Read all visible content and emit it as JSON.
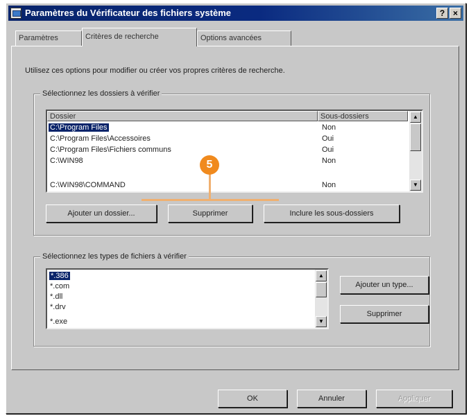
{
  "window": {
    "title": "Paramètres du Vérificateur des fichiers système",
    "help_label": "?",
    "close_label": "×"
  },
  "tabs": [
    {
      "label": "Paramètres"
    },
    {
      "label": "Critères de recherche"
    },
    {
      "label": "Options avancées"
    }
  ],
  "intro_text": "Utilisez ces options pour modifier ou créer vos propres critères de recherche.",
  "folders_group": {
    "legend": "Sélectionnez les dossiers à vérifier",
    "columns": [
      "Dossier",
      "Sous-dossiers"
    ],
    "rows": [
      {
        "folder": "C:\\Program Files",
        "subfolders": "Non"
      },
      {
        "folder": "C:\\Program Files\\Accessoires",
        "subfolders": "Oui"
      },
      {
        "folder": "C:\\Program Files\\Fichiers communs",
        "subfolders": "Oui"
      },
      {
        "folder": "C:\\WIN98",
        "subfolders": "Non"
      },
      {
        "folder": "C:\\WIN98\\COMMAND",
        "subfolders": "Non"
      }
    ],
    "add_button": "Ajouter un dossier...",
    "remove_button": "Supprimer",
    "include_button": "Inclure les sous-dossiers"
  },
  "types_group": {
    "legend": "Sélectionnez les types de fichiers à vérifier",
    "items": [
      "*.386",
      "*.com",
      "*.dll",
      "*.drv",
      "*.exe"
    ],
    "add_button": "Ajouter un type...",
    "remove_button": "Supprimer"
  },
  "footer": {
    "ok": "OK",
    "cancel": "Annuler",
    "apply": "Appliquer"
  },
  "callout": {
    "number": "5",
    "color": "#f08a1e"
  }
}
